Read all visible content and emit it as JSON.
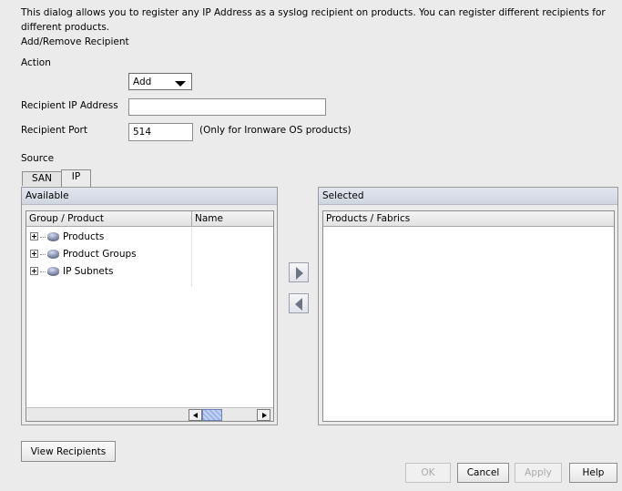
{
  "intro_text": "This dialog allows you to register any IP Address as a syslog recipient on products. You can register different recipients for different products.",
  "section_title": "Add/Remove Recipient",
  "action": {
    "label": "Action",
    "value": "Add"
  },
  "recipient_ip": {
    "label": "Recipient IP Address",
    "value": ""
  },
  "recipient_port": {
    "label": "Recipient Port",
    "value": "514",
    "note": "(Only for Ironware OS products)"
  },
  "source": {
    "label": "Source",
    "tabs": [
      {
        "label": "SAN"
      },
      {
        "label": "IP"
      }
    ],
    "active_tab": "IP"
  },
  "available": {
    "title": "Available",
    "columns": [
      "Group / Product",
      "Name"
    ],
    "items": [
      {
        "label": "Products",
        "icon": "product-icon"
      },
      {
        "label": "Product Groups",
        "icon": "product-group-icon"
      },
      {
        "label": "IP Subnets",
        "icon": "subnet-icon"
      }
    ]
  },
  "selected": {
    "title": "Selected",
    "columns": [
      "Products / Fabrics"
    ]
  },
  "buttons": {
    "view_recipients": "View Recipients",
    "ok": "OK",
    "cancel": "Cancel",
    "apply": "Apply",
    "help": "Help"
  }
}
